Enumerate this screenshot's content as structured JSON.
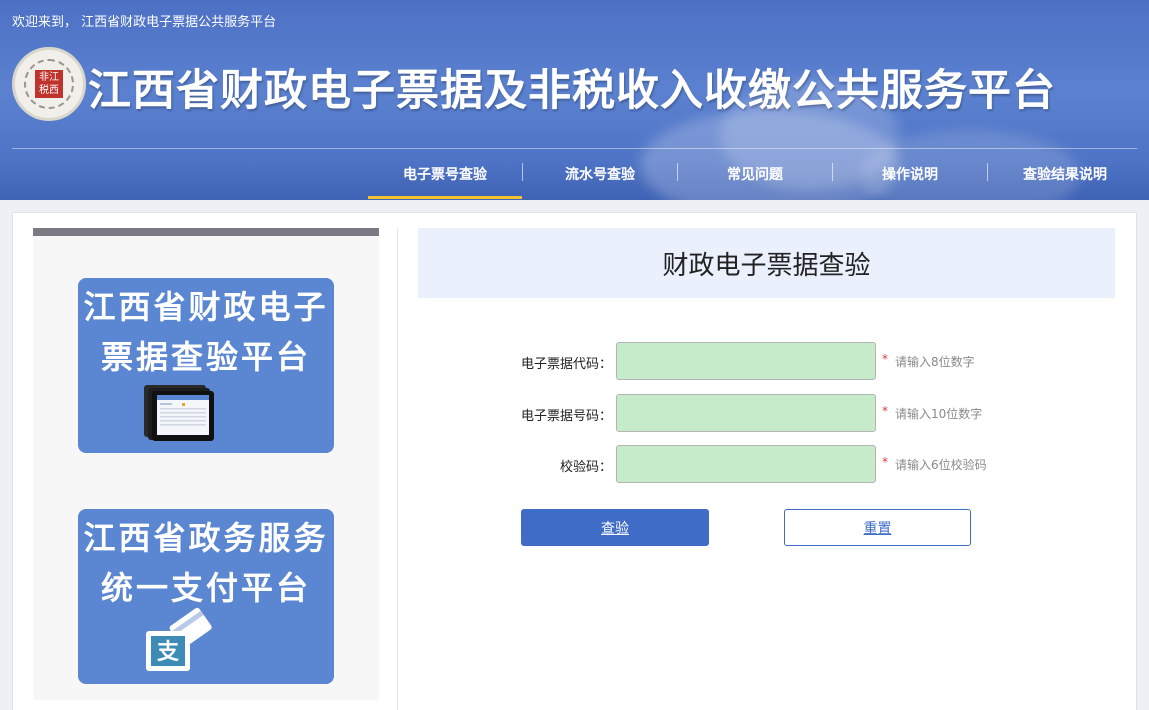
{
  "header": {
    "welcome": "欢迎来到， 江西省财政电子票据公共服务平台",
    "title": "江西省财政电子票据及非税收入收缴公共服务平台",
    "logo_text": "非江税西"
  },
  "nav": {
    "items": [
      {
        "label": "电子票号查验",
        "active": true
      },
      {
        "label": "流水号查验",
        "active": false
      },
      {
        "label": "常见问题",
        "active": false
      },
      {
        "label": "操作说明",
        "active": false
      },
      {
        "label": "查验结果说明",
        "active": false
      }
    ],
    "active_color": "#f2c230"
  },
  "sidebar": {
    "cards": [
      {
        "text": "江西省财政电子\n票据查验平台",
        "icon": "tablet-icon"
      },
      {
        "text": "江西省政务服务\n统一支付平台",
        "icon": "payment-card-icon"
      }
    ]
  },
  "form": {
    "title": "财政电子票据查验",
    "fields": [
      {
        "label": "电子票据代码：",
        "value": "",
        "required": "*",
        "hint": "请输入8位数字"
      },
      {
        "label": "电子票据号码：",
        "value": "",
        "required": "*",
        "hint": "请输入10位数字"
      },
      {
        "label": "校验码：",
        "value": "",
        "required": "*",
        "hint": "请输入6位校验码"
      }
    ],
    "check_button": "查验",
    "reset_button": "重置"
  },
  "colors": {
    "header_blue": "#4d70c4",
    "card_blue": "#5b86d1",
    "input_green": "#c6ebcb",
    "button_blue": "#3f6cc7"
  }
}
